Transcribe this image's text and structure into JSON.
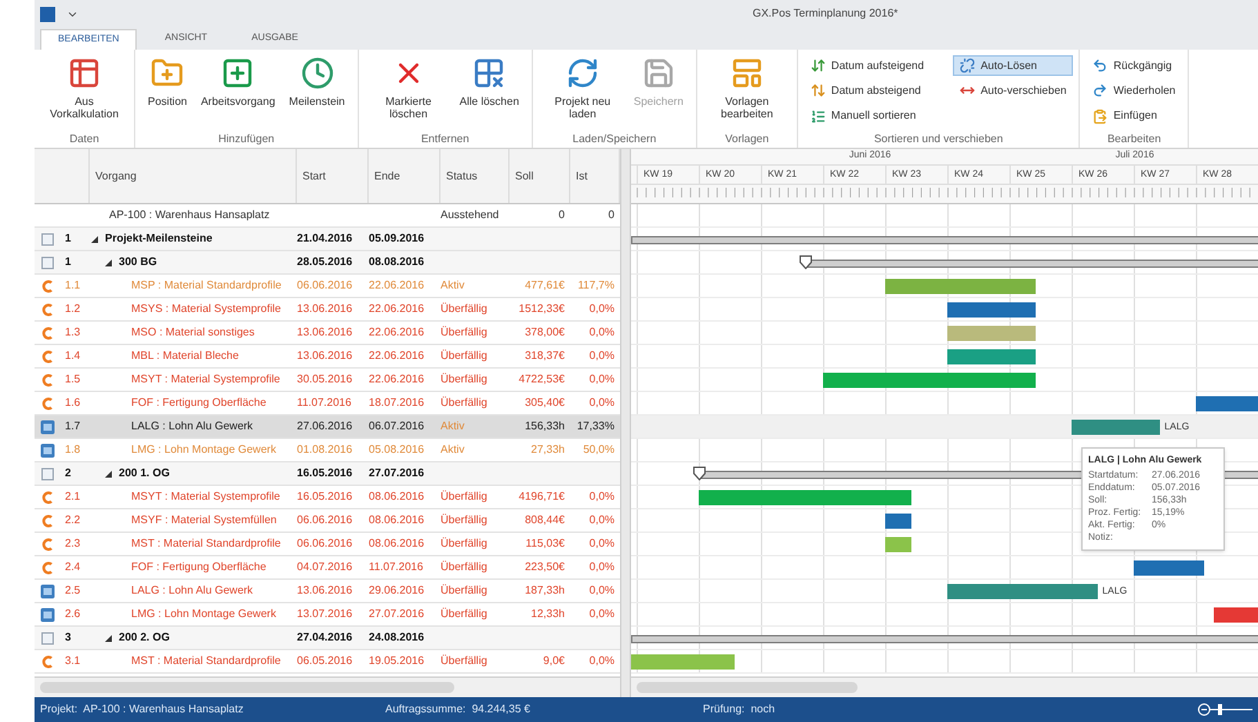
{
  "window": {
    "title": "GX.Pos Terminplanung 2016*"
  },
  "ribbon": {
    "tabs": [
      {
        "label": "BEARBEITEN",
        "selected": true
      },
      {
        "label": "ANSICHT",
        "selected": false
      },
      {
        "label": "AUSGABE",
        "selected": false
      }
    ],
    "groups": [
      {
        "label": "Daten",
        "items": [
          {
            "label": "Aus Vorkalkulation",
            "kind": "large",
            "disabled": false,
            "selected": false
          }
        ]
      },
      {
        "label": "Hinzufügen",
        "items": [
          {
            "label": "Position",
            "kind": "large",
            "disabled": false,
            "selected": false
          },
          {
            "label": "Arbeitsvorgang",
            "kind": "large",
            "disabled": false,
            "selected": false
          },
          {
            "label": "Meilenstein",
            "kind": "large",
            "disabled": false,
            "selected": false
          }
        ]
      },
      {
        "label": "Entfernen",
        "items": [
          {
            "label": "Markierte löschen",
            "kind": "large",
            "disabled": false,
            "selected": false
          },
          {
            "label": "Alle löschen",
            "kind": "large",
            "disabled": false,
            "selected": false
          }
        ]
      },
      {
        "label": "Laden/Speichern",
        "items": [
          {
            "label": "Projekt neu laden",
            "kind": "large",
            "disabled": false,
            "selected": false
          },
          {
            "label": "Speichern",
            "kind": "large",
            "disabled": true,
            "selected": false
          }
        ]
      },
      {
        "label": "Vorlagen",
        "items": [
          {
            "label": "Vorlagen bearbeiten",
            "kind": "large",
            "disabled": false,
            "selected": false
          }
        ]
      },
      {
        "label": "Sortieren und verschieben",
        "items": [
          {
            "label": "Datum aufsteigend",
            "kind": "small",
            "disabled": false,
            "selected": false
          },
          {
            "label": "Datum absteigend",
            "kind": "small",
            "disabled": false,
            "selected": false
          },
          {
            "label": "Manuell sortieren",
            "kind": "small",
            "disabled": false,
            "selected": false
          },
          {
            "label": "Auto-Lösen",
            "kind": "small",
            "disabled": false,
            "selected": true
          },
          {
            "label": "Auto-verschieben",
            "kind": "small",
            "disabled": false,
            "selected": false
          }
        ]
      },
      {
        "label": "Bearbeiten",
        "items": [
          {
            "label": "Rückgängig",
            "kind": "small",
            "disabled": false,
            "selected": false
          },
          {
            "label": "Wiederholen",
            "kind": "small",
            "disabled": false,
            "selected": false
          },
          {
            "label": "Einfügen",
            "kind": "small",
            "disabled": false,
            "selected": false
          }
        ]
      }
    ]
  },
  "table": {
    "columns": [
      "Vorgang",
      "Start",
      "Ende",
      "Status",
      "Soll",
      "Ist"
    ],
    "project_row": {
      "name": "AP-100 : Warenhaus Hansaplatz",
      "status": "Ausstehend",
      "soll": "0",
      "ist": "0"
    },
    "rows": [
      {
        "number": "1",
        "name": "Projekt-Meilensteine",
        "start": "21.04.2016",
        "end": "05.09.2016",
        "kind": "summary",
        "expanded": true,
        "selected": false,
        "children": [
          {
            "number": "1",
            "name": "300 BG",
            "start": "28.05.2016",
            "end": "08.08.2016",
            "kind": "summary",
            "expanded": true,
            "selected": false,
            "children": [
              {
                "number": "1.1",
                "name": "MSP : Material Standardprofile",
                "start": "06.06.2016",
                "end": "22.06.2016",
                "status": "Aktiv",
                "soll": "477,61€",
                "ist": "117,7%",
                "kind": "material",
                "overdue": false,
                "selected": false,
                "color": "#7cb342"
              },
              {
                "number": "1.2",
                "name": "MSYS : Material Systemprofile",
                "start": "13.06.2016",
                "end": "22.06.2016",
                "status": "Überfällig",
                "soll": "1512,33€",
                "ist": "0,0%",
                "kind": "material",
                "overdue": true,
                "selected": false,
                "color": "#1f6fb2"
              },
              {
                "number": "1.3",
                "name": "MSO : Material sonstiges",
                "start": "13.06.2016",
                "end": "22.06.2016",
                "status": "Überfällig",
                "soll": "378,00€",
                "ist": "0,0%",
                "kind": "material",
                "overdue": true,
                "selected": false,
                "color": "#b9ba7c"
              },
              {
                "number": "1.4",
                "name": "MBL : Material Bleche",
                "start": "13.06.2016",
                "end": "22.06.2016",
                "status": "Überfällig",
                "soll": "318,37€",
                "ist": "0,0%",
                "kind": "material",
                "overdue": true,
                "selected": false,
                "color": "#1aa084"
              },
              {
                "number": "1.5",
                "name": "MSYT : Material Systemprofile",
                "start": "30.05.2016",
                "end": "22.06.2016",
                "status": "Überfällig",
                "soll": "4722,53€",
                "ist": "0,0%",
                "kind": "material",
                "overdue": true,
                "selected": false,
                "color": "#12b04c"
              },
              {
                "number": "1.6",
                "name": "FOF : Fertigung Oberfläche",
                "start": "11.07.2016",
                "end": "18.07.2016",
                "status": "Überfällig",
                "soll": "305,40€",
                "ist": "0,0%",
                "kind": "material",
                "overdue": true,
                "selected": false,
                "color": "#1f6fb2"
              },
              {
                "number": "1.7",
                "name": "LALG : Lohn Alu Gewerk",
                "start": "27.06.2016",
                "end": "06.07.2016",
                "status": "Aktiv",
                "soll": "156,33h",
                "ist": "17,33%",
                "kind": "labor",
                "overdue": false,
                "selected": true,
                "color": "#2f8f83",
                "bar_label": "LALG"
              },
              {
                "number": "1.8",
                "name": "LMG : Lohn Montage Gewerk",
                "start": "01.08.2016",
                "end": "05.08.2016",
                "status": "Aktiv",
                "soll": "27,33h",
                "ist": "50,0%",
                "kind": "labor",
                "overdue": false,
                "selected": false
              }
            ]
          },
          {
            "number": "2",
            "name": "200 1. OG",
            "start": "16.05.2016",
            "end": "27.07.2016",
            "kind": "summary",
            "expanded": true,
            "selected": false,
            "children": [
              {
                "number": "2.1",
                "name": "MSYT : Material Systemprofile",
                "start": "16.05.2016",
                "end": "08.06.2016",
                "status": "Überfällig",
                "soll": "4196,71€",
                "ist": "0,0%",
                "kind": "material",
                "overdue": true,
                "selected": false,
                "color": "#12b04c"
              },
              {
                "number": "2.2",
                "name": "MSYF : Material Systemfüllen",
                "start": "06.06.2016",
                "end": "08.06.2016",
                "status": "Überfällig",
                "soll": "808,44€",
                "ist": "0,0%",
                "kind": "material",
                "overdue": true,
                "selected": false,
                "color": "#1f6fb2"
              },
              {
                "number": "2.3",
                "name": "MST : Material Standardprofile",
                "start": "06.06.2016",
                "end": "08.06.2016",
                "status": "Überfällig",
                "soll": "115,03€",
                "ist": "0,0%",
                "kind": "material",
                "overdue": true,
                "selected": false,
                "color": "#8bc34a"
              },
              {
                "number": "2.4",
                "name": "FOF : Fertigung Oberfläche",
                "start": "04.07.2016",
                "end": "11.07.2016",
                "status": "Überfällig",
                "soll": "223,50€",
                "ist": "0,0%",
                "kind": "material",
                "overdue": true,
                "selected": false,
                "color": "#1f6fb2"
              },
              {
                "number": "2.5",
                "name": "LALG : Lohn Alu Gewerk",
                "start": "13.06.2016",
                "end": "29.06.2016",
                "status": "Überfällig",
                "soll": "187,33h",
                "ist": "0,0%",
                "kind": "labor",
                "overdue": true,
                "selected": false,
                "color": "#2f8f83",
                "bar_label": "LALG"
              },
              {
                "number": "2.6",
                "name": "LMG : Lohn Montage Gewerk",
                "start": "13.07.2016",
                "end": "27.07.2016",
                "status": "Überfällig",
                "soll": "12,33h",
                "ist": "0,0%",
                "kind": "labor",
                "overdue": true,
                "selected": false,
                "color": "#e53935"
              }
            ]
          },
          {
            "number": "3",
            "name": "200 2. OG",
            "start": "27.04.2016",
            "end": "24.08.2016",
            "kind": "summary",
            "expanded": true,
            "selected": false,
            "children": [
              {
                "number": "3.1",
                "name": "MST : Material Standardprofile",
                "start": "06.05.2016",
                "end": "19.05.2016",
                "status": "Überfällig",
                "soll": "9,0€",
                "ist": "0,0%",
                "kind": "material",
                "overdue": true,
                "selected": false,
                "color": "#8bc34a"
              }
            ]
          }
        ]
      }
    ]
  },
  "gantt": {
    "months": [
      "Juni 2016",
      "Juli 2016"
    ],
    "weeks": [
      "KW 19",
      "KW 20",
      "KW 21",
      "KW 22",
      "KW 23",
      "KW 24",
      "KW 25",
      "KW 26",
      "KW 27",
      "KW 28"
    ],
    "tooltip": {
      "title": "LALG | Lohn Alu Gewerk",
      "fields": [
        {
          "label": "Startdatum:",
          "value": "27.06.2016"
        },
        {
          "label": "Enddatum:",
          "value": "05.07.2016"
        },
        {
          "label": "Soll:",
          "value": "156,33h"
        },
        {
          "label": "Proz. Fertig:",
          "value": "15,19%"
        },
        {
          "label": "Akt. Fertig:",
          "value": "0%"
        },
        {
          "label": "Notiz:"
        }
      ]
    }
  },
  "status_bar": {
    "project": "Projekt:  AP-100 : Warenhaus Hansaplatz",
    "sum": "Auftragssumme:  94.244,35 €",
    "check": "Prüfung:  noch"
  }
}
